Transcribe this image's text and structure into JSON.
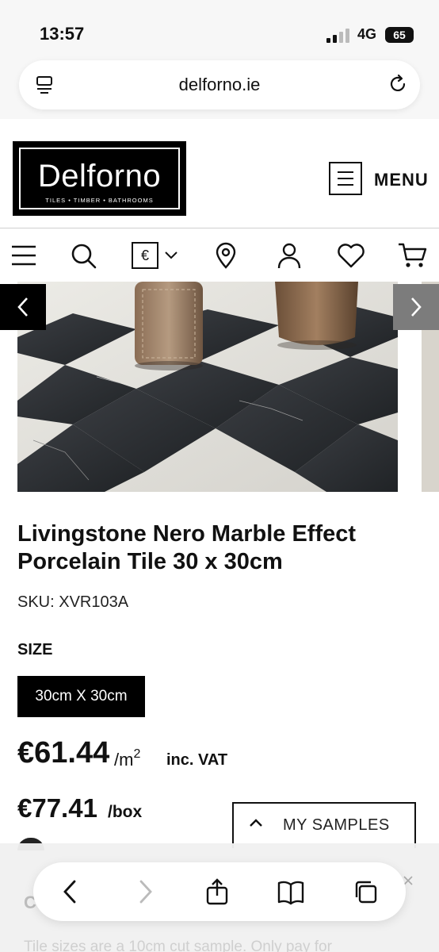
{
  "status_bar": {
    "time": "13:57",
    "network": "4G",
    "battery": "65"
  },
  "browser": {
    "url": "delforno.ie"
  },
  "header": {
    "logo_name": "Delforno",
    "logo_tagline": "TILES • TIMBER • BATHROOMS",
    "menu_label": "MENU"
  },
  "toolbar": {
    "currency_symbol": "€"
  },
  "product": {
    "title": "Livingstone Nero Marble Effect Porcelain Tile 30 x 30cm",
    "sku": "SKU: XVR103A",
    "size_heading": "SIZE",
    "size_selected": "30cm X 30cm",
    "price_per_m2": "€61.44",
    "price_per_m2_unit": "/m",
    "price_per_m2_unit_sup": "2",
    "price_vat_note": "inc. VAT",
    "price_per_box": "€77.41",
    "price_per_box_unit": "/box"
  },
  "samples": {
    "label": "MY SAMPLES"
  },
  "obscured": {
    "heading_letter": "C",
    "line": "Tile sizes are a 10cm cut sample. Only pay for"
  },
  "colors": {
    "brand": "#000000",
    "accent_dark": "#111111",
    "arrow_inactive": "#7c7c7c"
  },
  "icons": [
    "tabs-icon",
    "reload-icon",
    "hamburger-icon",
    "search-icon",
    "currency-icon",
    "chevron-down-icon",
    "location-pin-icon",
    "account-icon",
    "heart-icon",
    "cart-icon",
    "arrow-left-icon",
    "arrow-right-icon",
    "share-icon",
    "bookmarks-icon",
    "tabs-overview-icon"
  ]
}
